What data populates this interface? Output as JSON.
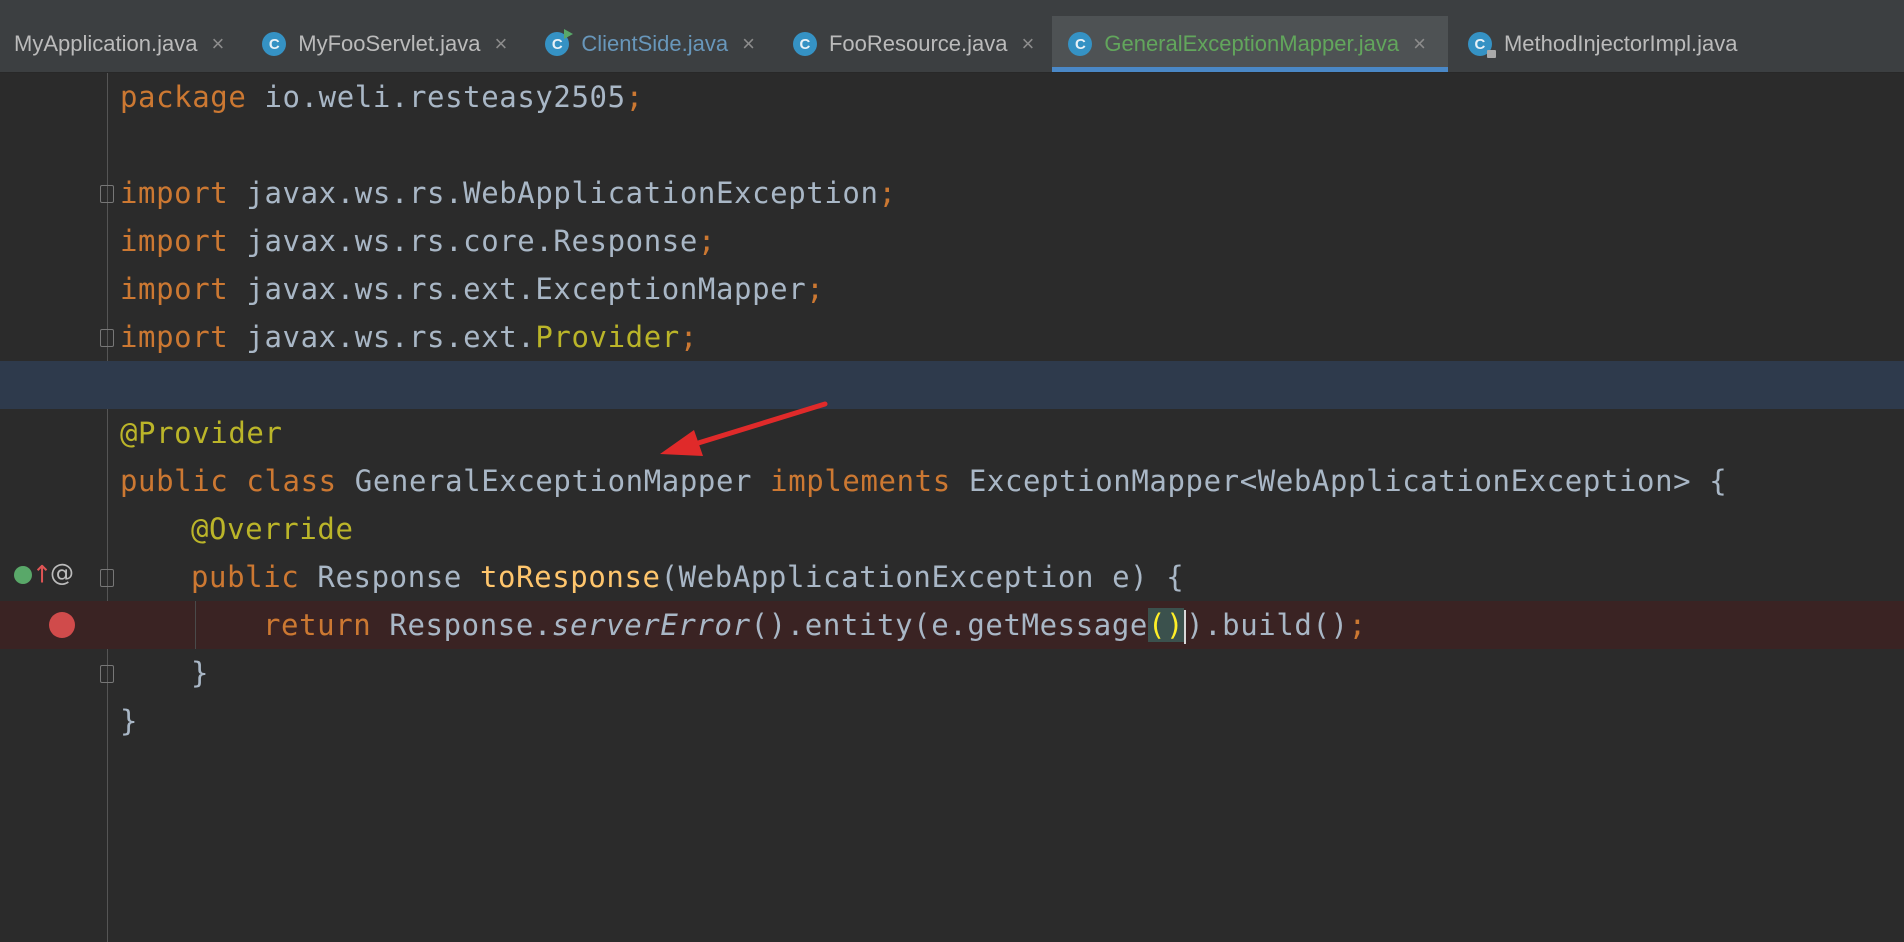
{
  "tabs": [
    {
      "label": "MyApplication.java",
      "active": false,
      "icon": "none"
    },
    {
      "label": "MyFooServlet.java",
      "active": false,
      "icon": "class-icon"
    },
    {
      "label": "ClientSide.java",
      "active": false,
      "icon": "runnable-class-icon"
    },
    {
      "label": "FooResource.java",
      "active": false,
      "icon": "class-icon"
    },
    {
      "label": "GeneralExceptionMapper.java",
      "active": true,
      "icon": "class-icon"
    },
    {
      "label": "MethodInjectorImpl.java",
      "active": false,
      "icon": "locked-class-icon"
    }
  ],
  "tab_close_glyph": "×",
  "tab_class_glyph": "C",
  "code": {
    "l1": {
      "kw": "package",
      "rest": " io.weli.resteasy2505",
      "semi": ";"
    },
    "l3": {
      "kw": "import",
      "rest": " javax.ws.rs.WebApplicationException",
      "semi": ";"
    },
    "l4": {
      "kw": "import",
      "rest": " javax.ws.rs.core.Response",
      "semi": ";"
    },
    "l5": {
      "kw": "import",
      "rest": " javax.ws.rs.ext.ExceptionMapper",
      "semi": ";"
    },
    "l6": {
      "kw": "import",
      "rest": " javax.ws.rs.ext.",
      "ann": "Provider",
      "semi": ";"
    },
    "l8": {
      "ann": "@Provider"
    },
    "l9": {
      "kw1": "public class",
      "name": " GeneralExceptionMapper ",
      "kw2": "implements",
      "rest": " ExceptionMapper<WebApplicationException> {"
    },
    "l10": {
      "ann": "@Override"
    },
    "l11": {
      "kw": "public",
      "t": " Response ",
      "fn": "toResponse",
      "rest": "(WebApplicationException e) {"
    },
    "l12": {
      "kw": "return",
      "a": " Response.",
      "it": "serverError",
      "b": "().entity(e.getMessage",
      "hl": "()",
      "c": ").build()",
      "semi": ";"
    },
    "l13": {
      "text": "}"
    },
    "l14": {
      "text": "}"
    }
  },
  "gutter": {
    "override_marker": "↑",
    "implements_marker": "@",
    "breakpoint_line": 12
  },
  "colors": {
    "keyword": "#cc7832",
    "annotation": "#bbb529",
    "method": "#ffc66d",
    "text": "#a9b7c6",
    "breakpoint": "#d04b4b",
    "arrow": "#e02a2a"
  }
}
